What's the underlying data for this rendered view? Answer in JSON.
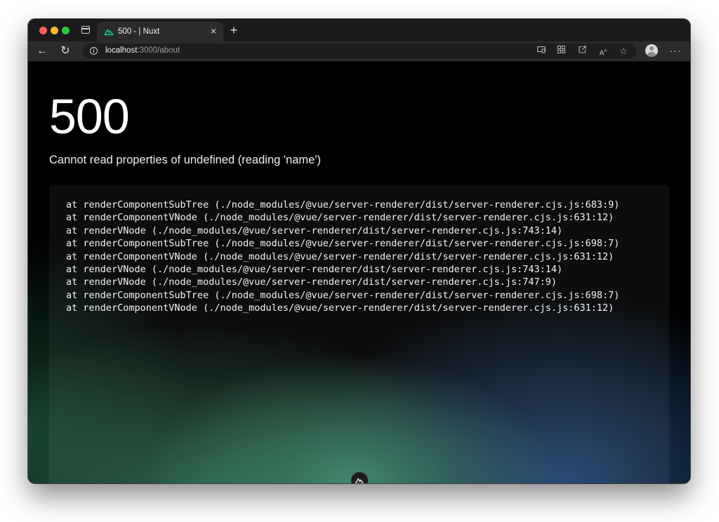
{
  "browser": {
    "tab": {
      "title": "500 - | Nuxt",
      "close_symbol": "×"
    },
    "new_tab_symbol": "+",
    "back_symbol": "←",
    "reload_symbol": "↻",
    "url_host": "localhost",
    "url_rest": ":3000/about",
    "more_symbol": "···",
    "toolbar_icons": [
      "cast-icon",
      "apps-icon",
      "share-icon",
      "read-aloud-icon",
      "favorite-star-icon"
    ]
  },
  "error": {
    "status_code": "500",
    "message": "Cannot read properties of undefined (reading 'name')",
    "stack": [
      "at renderComponentSubTree (./node_modules/@vue/server-renderer/dist/server-renderer.cjs.js:683:9)",
      "at renderComponentVNode (./node_modules/@vue/server-renderer/dist/server-renderer.cjs.js:631:12)",
      "at renderVNode (./node_modules/@vue/server-renderer/dist/server-renderer.cjs.js:743:14)",
      "at renderComponentSubTree (./node_modules/@vue/server-renderer/dist/server-renderer.cjs.js:698:7)",
      "at renderComponentVNode (./node_modules/@vue/server-renderer/dist/server-renderer.cjs.js:631:12)",
      "at renderVNode (./node_modules/@vue/server-renderer/dist/server-renderer.cjs.js:743:14)",
      "at renderVNode (./node_modules/@vue/server-renderer/dist/server-renderer.cjs.js:747:9)",
      "at renderComponentSubTree (./node_modules/@vue/server-renderer/dist/server-renderer.cjs.js:698:7)",
      "at renderComponentVNode (./node_modules/@vue/server-renderer/dist/server-renderer.cjs.js:631:12)"
    ]
  },
  "colors": {
    "nuxt_green": "#00dc82",
    "background": "#000000"
  }
}
